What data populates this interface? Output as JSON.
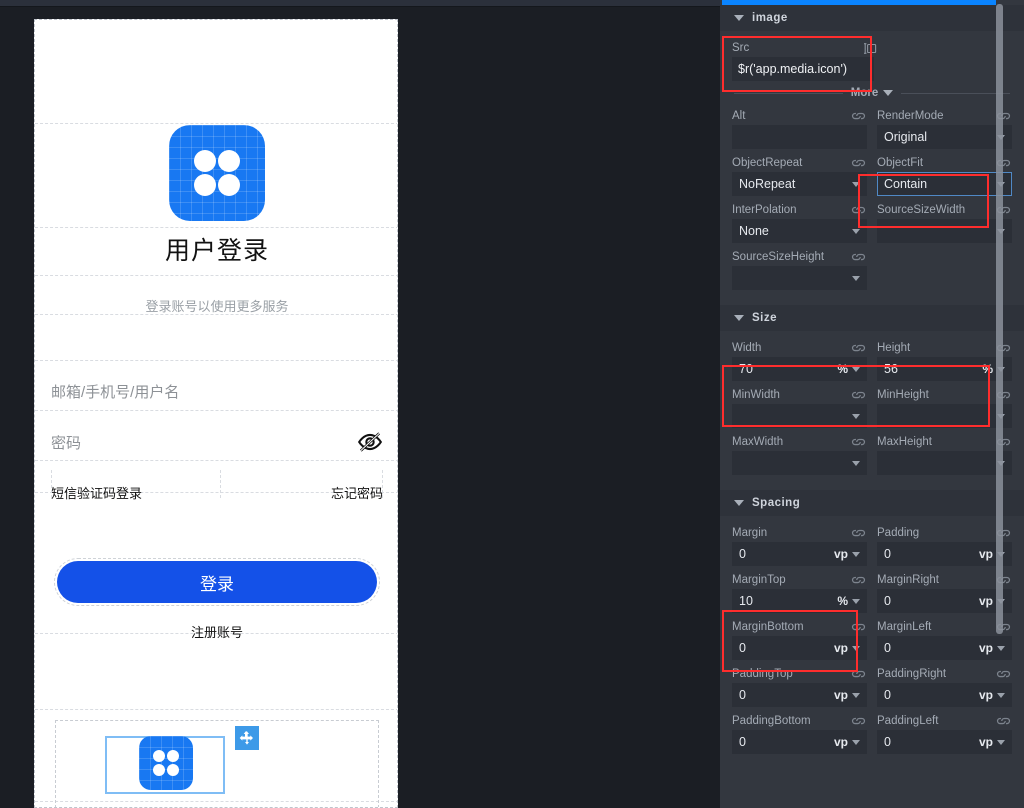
{
  "preview": {
    "app_icon_name": "four-petal-app-icon",
    "title": "用户登录",
    "subtitle": "登录账号以使用更多服务",
    "username_placeholder": "邮箱/手机号/用户名",
    "password_placeholder": "密码",
    "password_toggle_icon": "eye-off-icon",
    "sms_login_link": "短信验证码登录",
    "forgot_password_link": "忘记密码",
    "login_button": "登录",
    "register_link": "注册账号",
    "selected_element_icon": "four-petal-app-icon",
    "drag_handle_icon": "move-arrows-icon",
    "accent_color": "#1451e8",
    "icon_color": "#1878f2"
  },
  "inspector": {
    "accent_color": "#0a84ff",
    "highlight_color": "#ff2d2d",
    "sections": [
      {
        "name": "image",
        "title": "image",
        "caret_icon": "chevron-down-icon",
        "src": {
          "label": "Src",
          "binding_icon": "binding-reference-icon",
          "value": "$r('app.media.icon')"
        },
        "more": {
          "label": "More",
          "caret_icon": "chevron-down-icon"
        },
        "fields": [
          {
            "label": "Alt",
            "value": "",
            "unit": "",
            "has_chevron": false,
            "link_icon": "link-icon"
          },
          {
            "label": "RenderMode",
            "value": "Original",
            "unit": "",
            "has_chevron": true,
            "link_icon": "link-icon"
          },
          {
            "label": "ObjectRepeat",
            "value": "NoRepeat",
            "unit": "",
            "has_chevron": true,
            "link_icon": "link-icon"
          },
          {
            "label": "ObjectFit",
            "value": "Contain",
            "unit": "",
            "has_chevron": true,
            "link_icon": "link-icon",
            "focused": true
          },
          {
            "label": "InterPolation",
            "value": "None",
            "unit": "",
            "has_chevron": true,
            "link_icon": "link-icon"
          },
          {
            "label": "SourceSizeWidth",
            "value": "",
            "unit": "",
            "has_chevron": true,
            "link_icon": "link-icon"
          },
          {
            "label": "SourceSizeHeight",
            "value": "",
            "unit": "",
            "has_chevron": true,
            "link_icon": "link-icon"
          },
          {
            "label": "",
            "value": "",
            "unit": "",
            "has_chevron": false,
            "link_icon": ""
          }
        ]
      },
      {
        "name": "size",
        "title": "Size",
        "caret_icon": "chevron-down-icon",
        "fields": [
          {
            "label": "Width",
            "value": "70",
            "unit": "%",
            "has_chevron": true,
            "link_icon": "link-icon"
          },
          {
            "label": "Height",
            "value": "56",
            "unit": "%",
            "has_chevron": true,
            "link_icon": "link-icon"
          },
          {
            "label": "MinWidth",
            "value": "",
            "unit": "",
            "has_chevron": true,
            "link_icon": "link-icon"
          },
          {
            "label": "MinHeight",
            "value": "",
            "unit": "",
            "has_chevron": true,
            "link_icon": "link-icon"
          },
          {
            "label": "MaxWidth",
            "value": "",
            "unit": "",
            "has_chevron": true,
            "link_icon": "link-icon"
          },
          {
            "label": "MaxHeight",
            "value": "",
            "unit": "",
            "has_chevron": true,
            "link_icon": "link-icon"
          }
        ]
      },
      {
        "name": "spacing",
        "title": "Spacing",
        "caret_icon": "chevron-down-icon",
        "fields": [
          {
            "label": "Margin",
            "value": "0",
            "unit": "vp",
            "has_chevron": true,
            "link_icon": "link-icon"
          },
          {
            "label": "Padding",
            "value": "0",
            "unit": "vp",
            "has_chevron": true,
            "link_icon": "link-icon"
          },
          {
            "label": "MarginTop",
            "value": "10",
            "unit": "%",
            "has_chevron": true,
            "link_icon": "link-icon"
          },
          {
            "label": "MarginRight",
            "value": "0",
            "unit": "vp",
            "has_chevron": true,
            "link_icon": "link-icon"
          },
          {
            "label": "MarginBottom",
            "value": "0",
            "unit": "vp",
            "has_chevron": true,
            "link_icon": "link-icon"
          },
          {
            "label": "MarginLeft",
            "value": "0",
            "unit": "vp",
            "has_chevron": true,
            "link_icon": "link-icon"
          },
          {
            "label": "PaddingTop",
            "value": "0",
            "unit": "vp",
            "has_chevron": true,
            "link_icon": "link-icon"
          },
          {
            "label": "PaddingRight",
            "value": "0",
            "unit": "vp",
            "has_chevron": true,
            "link_icon": "link-icon"
          },
          {
            "label": "PaddingBottom",
            "value": "0",
            "unit": "vp",
            "has_chevron": true,
            "link_icon": "link-icon"
          },
          {
            "label": "PaddingLeft",
            "value": "0",
            "unit": "vp",
            "has_chevron": true,
            "link_icon": "link-icon"
          }
        ]
      }
    ]
  }
}
